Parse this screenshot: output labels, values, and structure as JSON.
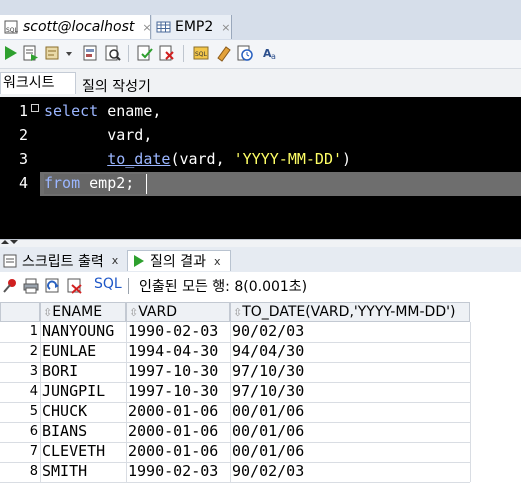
{
  "tabs": {
    "connection": "scott@localhost",
    "table": "EMP2",
    "close": "×"
  },
  "subtabs": {
    "worksheet": "워크시트",
    "query_builder": "질의 작성기"
  },
  "editor": {
    "line_numbers": [
      "1",
      "2",
      "3",
      "4"
    ],
    "lines": [
      {
        "kw": "select",
        "rest": " ename,"
      },
      {
        "indent": "       ",
        "rest": "vard,"
      },
      {
        "indent": "       ",
        "fn": "to_date",
        "rest": "(vard, ",
        "str": "'YYYY-MM-DD'",
        "tail": ")"
      },
      {
        "kw": "from",
        "rest": " emp2;"
      }
    ]
  },
  "result_tabs": {
    "script_output": "스크립트 출력",
    "query_result": "질의 결과",
    "close": "x"
  },
  "result_toolbar": {
    "sql_label": "SQL",
    "status": "인출된 모든 행: 8(0.001초)"
  },
  "grid": {
    "columns": [
      "ENAME",
      "VARD",
      "TO_DATE(VARD,'YYYY-MM-DD')"
    ],
    "rows": [
      {
        "n": "1",
        "ename": "NANYOUNG",
        "vard": "1990-02-03",
        "to_date": "90/02/03"
      },
      {
        "n": "2",
        "ename": "EUNLAE",
        "vard": "1994-04-30",
        "to_date": "94/04/30"
      },
      {
        "n": "3",
        "ename": "BORI",
        "vard": "1997-10-30",
        "to_date": "97/10/30"
      },
      {
        "n": "4",
        "ename": "JUNGPIL",
        "vard": "1997-10-30",
        "to_date": "97/10/30"
      },
      {
        "n": "5",
        "ename": "CHUCK",
        "vard": "2000-01-06",
        "to_date": "00/01/06"
      },
      {
        "n": "6",
        "ename": "BIANS",
        "vard": "2000-01-06",
        "to_date": "00/01/06"
      },
      {
        "n": "7",
        "ename": "CLEVETH",
        "vard": "2000-01-06",
        "to_date": "00/01/06"
      },
      {
        "n": "8",
        "ename": "SMITH",
        "vard": "1990-02-03",
        "to_date": "90/02/03"
      }
    ]
  },
  "colors": {
    "editor_bg": "#000000",
    "keyword": "#9bb6ff",
    "string": "#ffff66",
    "link": "#1e57c7"
  },
  "icons": [
    "sql-sheet-icon",
    "table-grid-icon",
    "run-icon",
    "run-script-icon",
    "commit-icon",
    "rollback-icon",
    "sql-tuning-icon",
    "eraser-icon",
    "history-icon",
    "format-icon",
    "pin-icon",
    "print-icon",
    "refresh-icon",
    "export-icon",
    "script-output-icon",
    "query-result-icon",
    "sort-icon"
  ]
}
